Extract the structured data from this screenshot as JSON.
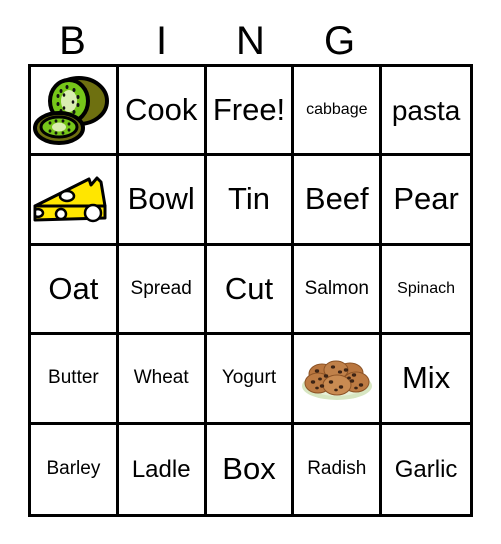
{
  "card": {
    "type": "bingo-card",
    "columns": 5,
    "rows": 5,
    "background_color": "#ffffff",
    "grid_line_color": "#000000"
  },
  "header": {
    "letters": [
      {
        "label": "B"
      },
      {
        "label": "I"
      },
      {
        "label": "N"
      },
      {
        "label": "G"
      },
      {
        "label": ""
      }
    ]
  },
  "grid": {
    "rows": [
      {
        "cells": [
          {
            "kind": "image",
            "icon": "kiwi-fruit-icon",
            "label": ""
          },
          {
            "kind": "text",
            "label": "Cook",
            "size": "t-xl"
          },
          {
            "kind": "text",
            "label": "Free!",
            "size": "t-xl"
          },
          {
            "kind": "text",
            "label": "cabbage",
            "size": "t-xs"
          },
          {
            "kind": "text",
            "label": "pasta",
            "size": "t-lg"
          }
        ]
      },
      {
        "cells": [
          {
            "kind": "image",
            "icon": "swiss-cheese-icon",
            "label": ""
          },
          {
            "kind": "text",
            "label": "Bowl",
            "size": "t-xl"
          },
          {
            "kind": "text",
            "label": "Tin",
            "size": "t-xl"
          },
          {
            "kind": "text",
            "label": "Beef",
            "size": "t-xl"
          },
          {
            "kind": "text",
            "label": "Pear",
            "size": "t-xl"
          }
        ]
      },
      {
        "cells": [
          {
            "kind": "text",
            "label": "Oat",
            "size": "t-xl"
          },
          {
            "kind": "text",
            "label": "Spread",
            "size": "t-sm"
          },
          {
            "kind": "text",
            "label": "Cut",
            "size": "t-xl"
          },
          {
            "kind": "text",
            "label": "Salmon",
            "size": "t-sm"
          },
          {
            "kind": "text",
            "label": "Spinach",
            "size": "t-xs"
          }
        ]
      },
      {
        "cells": [
          {
            "kind": "text",
            "label": "Butter",
            "size": "t-sm"
          },
          {
            "kind": "text",
            "label": "Wheat",
            "size": "t-sm"
          },
          {
            "kind": "text",
            "label": "Yogurt",
            "size": "t-sm"
          },
          {
            "kind": "image",
            "icon": "plate-of-cookies-icon",
            "label": ""
          },
          {
            "kind": "text",
            "label": "Mix",
            "size": "t-xl"
          }
        ]
      },
      {
        "cells": [
          {
            "kind": "text",
            "label": "Barley",
            "size": "t-sm"
          },
          {
            "kind": "text",
            "label": "Ladle",
            "size": "t-md"
          },
          {
            "kind": "text",
            "label": "Box",
            "size": "t-xl"
          },
          {
            "kind": "text",
            "label": "Radish",
            "size": "t-sm"
          },
          {
            "kind": "text",
            "label": "Garlic",
            "size": "t-md"
          }
        ]
      }
    ]
  },
  "colors": {
    "kiwi_skin": "#6e7010",
    "kiwi_flesh": "#76c619",
    "kiwi_core": "#d9eeb0",
    "kiwi_seed": "#111111",
    "cheese_body": "#ffe600",
    "cheese_outline": "#000000",
    "cookie_body": "#b9763f",
    "cookie_chip": "#3d2415",
    "plate": "#d7e6c2",
    "outline": "#000000"
  }
}
